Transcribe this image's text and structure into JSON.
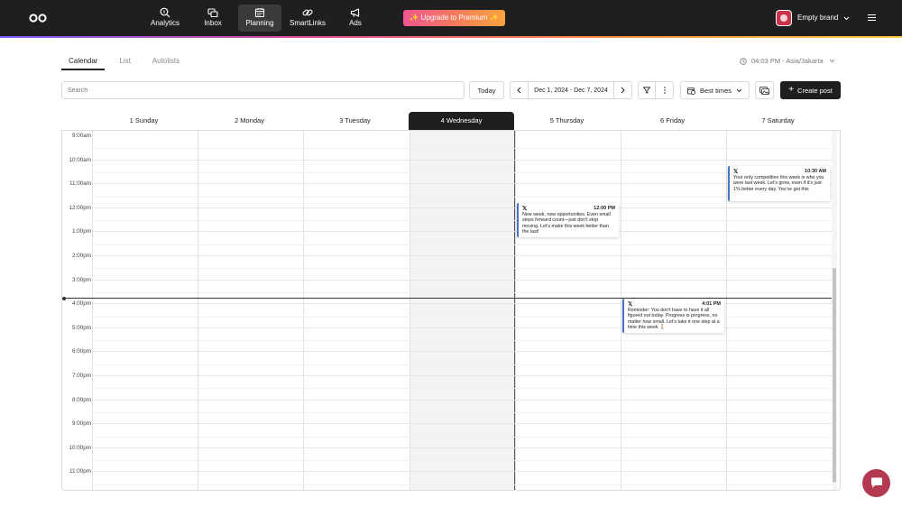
{
  "nav": {
    "items": [
      {
        "label": "Analytics",
        "icon": "analytics-icon"
      },
      {
        "label": "Inbox",
        "icon": "inbox-icon"
      },
      {
        "label": "Planning",
        "icon": "calendar-icon",
        "active": true
      },
      {
        "label": "SmartLinks",
        "icon": "link-icon"
      },
      {
        "label": "Ads",
        "icon": "megaphone-icon"
      }
    ],
    "upgrade_label": "Upgrade to Premium",
    "brand_name": "Empty brand"
  },
  "tabs": [
    {
      "label": "Calendar",
      "active": true
    },
    {
      "label": "List"
    },
    {
      "label": "Autolists"
    }
  ],
  "timezone": "04:03 PM - Asia/Jakarta",
  "toolbar": {
    "search_placeholder": "Search",
    "today_label": "Today",
    "date_range": "Dec 1, 2024 - Dec 7, 2024",
    "best_times_label": "Best times",
    "create_post_label": "Create post"
  },
  "calendar": {
    "days": [
      "1 Sunday",
      "2 Monday",
      "3 Tuesday",
      "4 Wednesday",
      "5 Thursday",
      "6 Friday",
      "7 Saturday"
    ],
    "today_index": 3,
    "hours": [
      "9:00am",
      "10:00am",
      "11:00am",
      "12:00pm",
      "1:00pm",
      "2:00pm",
      "3:00pm",
      "4:00pm",
      "5:00pm",
      "6:00pm",
      "7:00pm",
      "8:00pm",
      "9:00pm",
      "10:00pm",
      "11:00pm"
    ],
    "events": [
      {
        "day": 4,
        "time": "12:00 PM",
        "network": "x-icon",
        "text": "New week, new opportunities. Even small steps forward count—just don't stop moving. Let's make this week better than the last!"
      },
      {
        "day": 5,
        "time": "4:01 PM",
        "network": "x-icon",
        "text": "Reminder: You don't have to have it all figured out today. Progress is progress, no matter how small. Let's take it one step at a time this week 🚶"
      },
      {
        "day": 6,
        "time": "10:30 AM",
        "network": "x-icon",
        "text": "Your only competition this week is who you were last week. Let's grow, even if it's just 1% better every day. You've got this"
      }
    ]
  },
  "colors": {
    "accent": "#1f1f21",
    "event_border": "#4a74c9",
    "chat": "#b43a52"
  }
}
